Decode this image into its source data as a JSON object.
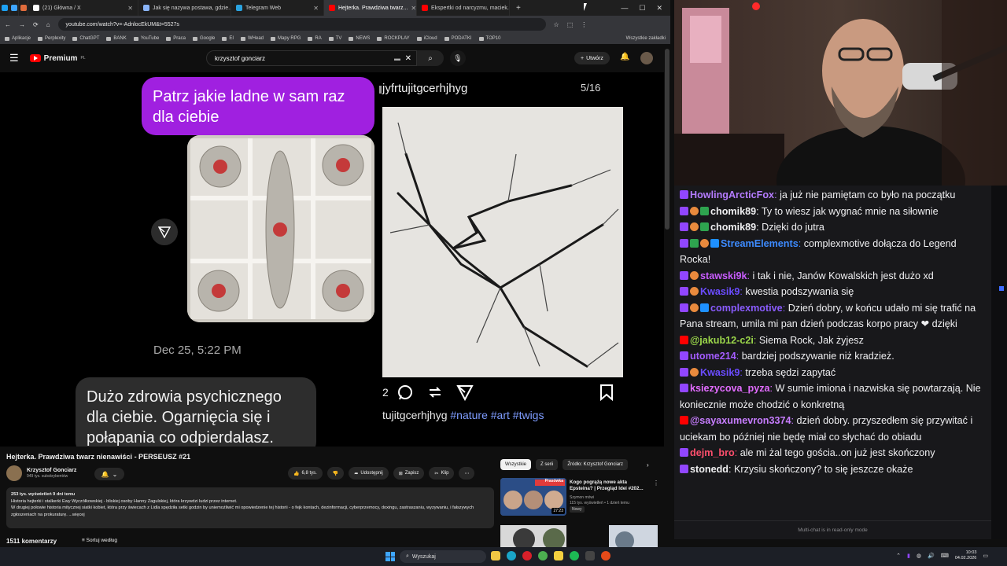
{
  "browser": {
    "tabs": [
      {
        "label": "",
        "color": "#1da1f2"
      },
      {
        "label": "",
        "color": "#3ea6ff"
      },
      {
        "label": "",
        "color": "#e06c3c"
      },
      {
        "label": "(21) Główna / X",
        "color": "#ffffff"
      },
      {
        "label": "Jak się nazywa postawa, gdzie...",
        "color": "#8ab4f8"
      },
      {
        "label": "Telegram Web",
        "color": "#2aa3e0"
      },
      {
        "label": "Hejterka. Prawdziwa twarz...",
        "color": "#ff0000",
        "active": true
      },
      {
        "label": "Ekspertki od narcyzmu, maciek...",
        "color": "#ff0000"
      }
    ],
    "url": "youtube.com/watch?v=-AdnlocEkUM&t=5527s",
    "bookmarks": [
      "Aplikacje",
      "Perplexity",
      "ChatGPT",
      "BANK",
      "YouTube",
      "Praca",
      "Google",
      "EI",
      "WHead",
      "Mapy RPG",
      "RA",
      "TV",
      "NEWS",
      "ROCKPLAY",
      "iCloud",
      "PODATKI",
      "TOP10"
    ],
    "all_bookmarks": "Wszystkie zakładki"
  },
  "yt_header": {
    "logo_text": "Premium",
    "logo_sup": "PL",
    "search_value": "krzysztof gonciarz",
    "create_label": "Utwórz"
  },
  "video": {
    "purple_message": "Patrz jakie ladne w sam raz dla ciebie",
    "date": "Dec 25, 5:22 PM",
    "gray_message": "Dużo zdrowia psychicznego dla ciebie. Ogarnięcia się i połapania co odpierdalasz.",
    "insta_username": "jyfrtujitgcerhjhyg",
    "slide_counter": "5/16",
    "like_count": "2",
    "caption_user": "tujitgcerhjhyg",
    "caption_tags": "#nature #art #twigs"
  },
  "video_info": {
    "title": "Hejterka. Prawdziwa twarz nienawiści - PERSEUSZ #21",
    "channel_name": "Krzysztof Gonciarz",
    "subscribers": "949 tys. subskrybentów",
    "likes": "6,8 tys.",
    "share": "Udostępnij",
    "save": "Zapisz",
    "clip": "Klip",
    "stats": "253 tys. wyświetleń  9 dni temu",
    "desc_1": "Historia hejterki i stalkerki Ewy Wyczółkowskiej - bliskiej osoby Hanny Zagulskiej, która krzywdzi ludzi przez internet.",
    "desc_2": "W drugiej połowie historia mitycznej siatki kobiet, która przy świecach z Lidla spędziła setki godzin by uniemożliwić mi opowiedzenie tej historii - o fejk kontach, dezinformacji, cyberprzemocy, doxingu, zastraszaniu, wyzywaniu, i fałszywych zgłoszeniach na prokuraturę. ...więcej",
    "comments": "1511 komentarzy",
    "sort": "Sortuj według"
  },
  "sidebar": {
    "chips": [
      "Wszystkie",
      "Z serii",
      "Źródło: Krzysztof Gonciarz"
    ],
    "rec": {
      "title": "Kogo pogrążą nowe akta Epsteina? | Przegląd Idei #202...",
      "channel": "Szymon mówi",
      "meta": "115 tys. wyświetleń • 1 dzień temu",
      "badge": "Nowy",
      "duration": "27:23",
      "thumb_label": "Prasówka"
    }
  },
  "chat": {
    "messages": [
      {
        "user": "HowlingArcticFox",
        "color": "#b57cff",
        "badges": [
          "tw"
        ],
        "text": "ja już nie pamiętam co było na początku"
      },
      {
        "user": "chomik89",
        "color": "#efeff1",
        "badges": [
          "tw",
          "fox",
          "ok"
        ],
        "text": "Ty to wiesz jak wygnać mnie na siłownie"
      },
      {
        "user": "chomik89",
        "color": "#efeff1",
        "badges": [
          "tw",
          "fox",
          "ok"
        ],
        "text": "Dzięki do jutra"
      },
      {
        "user": "StreamElements",
        "color": "#3d8bff",
        "badges": [
          "tw",
          "ok",
          "fox",
          "sw"
        ],
        "text": "complexmotive dołącza do Legend Rocka!"
      },
      {
        "user": "stawski9k",
        "color": "#c95cff",
        "badges": [
          "tw",
          "fox",
          "mic"
        ],
        "text": "i tak i nie, Janów Kowalskich jest dużo xd"
      },
      {
        "user": "Kwasik9",
        "color": "#6b4cff",
        "badges": [
          "tw",
          "fox"
        ],
        "text": "kwestia podszywania się"
      },
      {
        "user": "complexmotive",
        "color": "#8a5cff",
        "badges": [
          "tw",
          "fox",
          "sw"
        ],
        "text": "Dzień dobry, w końcu udało mi się trafić na Pana stream, umila mi pan dzień podczas korpo pracy ❤ dzięki"
      },
      {
        "user": "@jakub12-c2i",
        "color": "#9bd64a",
        "badges": [
          "yt"
        ],
        "text": "Siema Rock, Jak żyjesz"
      },
      {
        "user": "utome214",
        "color": "#a45cff",
        "badges": [
          "tw",
          "mic"
        ],
        "text": "bardziej podszywanie niż kradzież."
      },
      {
        "user": "Kwasik9",
        "color": "#6b4cff",
        "badges": [
          "tw",
          "fox"
        ],
        "text": "trzeba sędzi zapytać"
      },
      {
        "user": "ksiezycova_pyza",
        "color": "#e26cff",
        "badges": [
          "tw"
        ],
        "text": "W sumie imiona i nazwiska się powtarzają. Nie koniecznie może chodzić o konkretną"
      },
      {
        "user": "@sayaxumevron3374",
        "color": "#c77dff",
        "badges": [
          "yt"
        ],
        "text": "dzień dobry. przyszedłem się przywitać i uciekam bo później nie będę miał co słychać do obiadu"
      },
      {
        "user": "dejm_bro",
        "color": "#ff4f6d",
        "badges": [
          "tw"
        ],
        "text": "ale mi żal tego gościa..on już jest skończony"
      },
      {
        "user": "stonedd",
        "color": "#efeff1",
        "badges": [
          "tw"
        ],
        "text": "Krzysiu skończony? to się jeszcze okaże"
      }
    ],
    "readonly": "Multi-chat is in read-only mode"
  },
  "taskbar": {
    "search_placeholder": "Wyszukaj",
    "time": "10:03",
    "date": "04.02.2026"
  }
}
